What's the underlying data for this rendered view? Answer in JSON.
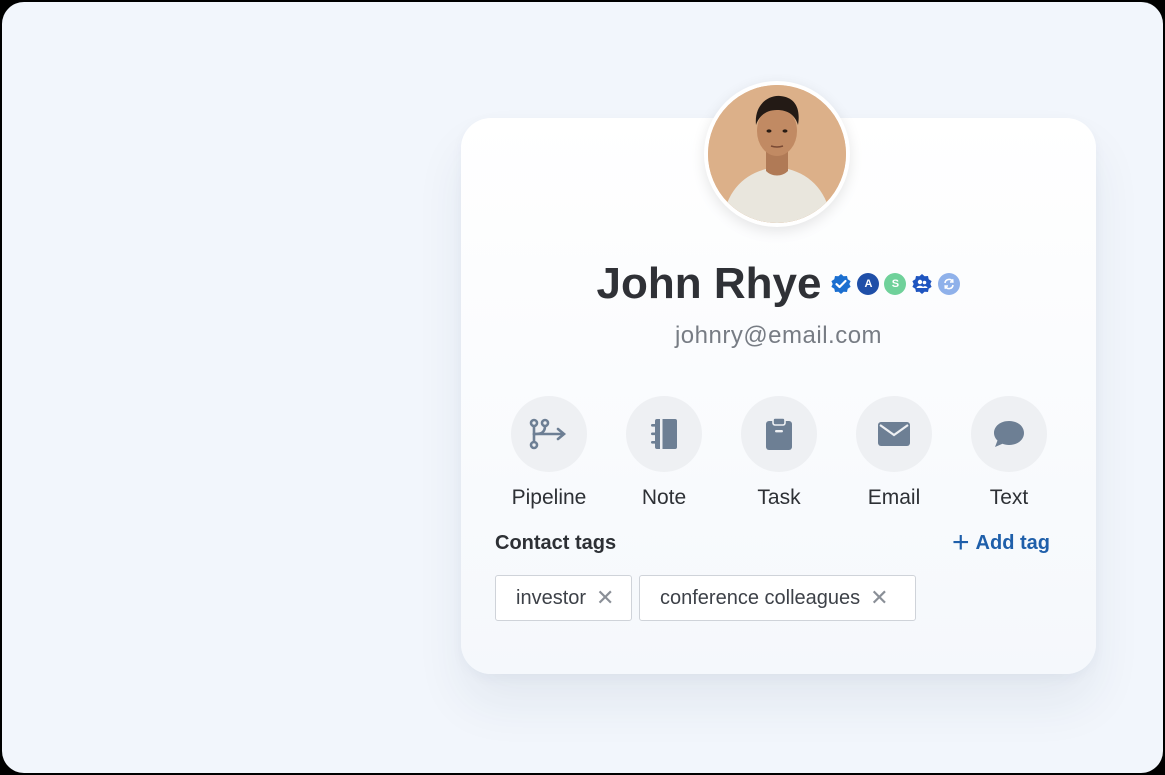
{
  "contact": {
    "name": "John Rhye",
    "email": "johnry@email.com",
    "badges": [
      {
        "icon": "verified-check-icon",
        "color": "#1b6fd0",
        "text": ""
      },
      {
        "icon": "a-badge-icon",
        "color": "#1f4fa8",
        "text": "A"
      },
      {
        "icon": "s-badge-icon",
        "color": "#6fd19a",
        "text": "S"
      },
      {
        "icon": "group-badge-icon",
        "color": "#1f55c0",
        "text": ""
      },
      {
        "icon": "sync-badge-icon",
        "color": "#8fb1ea",
        "text": ""
      }
    ]
  },
  "actions": [
    {
      "label": "Pipeline",
      "icon": "pipeline-icon"
    },
    {
      "label": "Note",
      "icon": "notebook-icon"
    },
    {
      "label": "Task",
      "icon": "clipboard-icon"
    },
    {
      "label": "Email",
      "icon": "envelope-icon"
    },
    {
      "label": "Text",
      "icon": "chat-bubble-icon"
    }
  ],
  "tags_section": {
    "title": "Contact tags",
    "add_label": "Add tag",
    "tags": [
      "investor",
      "conference colleagues"
    ]
  },
  "colors": {
    "accent": "#1f5faa",
    "icon_gray": "#6d7f94",
    "background": "#f2f6fc"
  }
}
